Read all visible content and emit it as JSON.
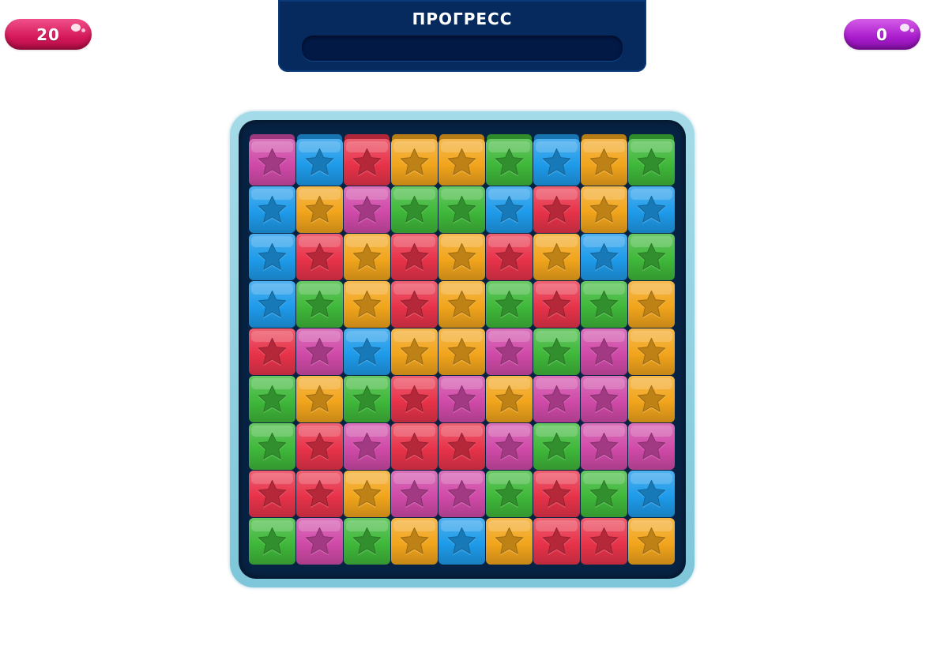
{
  "hud": {
    "moves_left": "20",
    "score": "0",
    "progress_label": "ПРОГРЕСС",
    "progress_fraction": 0
  },
  "colors": {
    "pink": "#d04aa8",
    "blue": "#1e9bea",
    "red": "#e8334a",
    "orange": "#f2a51c",
    "green": "#3fb83a",
    "board_bg": "#072344",
    "panel_bg": "#062a5e",
    "frame": "#9dd6e6"
  },
  "board": {
    "rows": [
      [
        "pink",
        "blue",
        "red",
        "orange",
        "orange",
        "green",
        "blue",
        "orange",
        "green"
      ],
      [
        "blue",
        "orange",
        "pink",
        "green",
        "green",
        "blue",
        "red",
        "orange",
        "blue"
      ],
      [
        "blue",
        "red",
        "orange",
        "red",
        "orange",
        "red",
        "orange",
        "blue",
        "green"
      ],
      [
        "blue",
        "green",
        "orange",
        "red",
        "orange",
        "green",
        "red",
        "green",
        "orange"
      ],
      [
        "red",
        "pink",
        "blue",
        "orange",
        "orange",
        "pink",
        "green",
        "pink",
        "orange"
      ],
      [
        "green",
        "orange",
        "green",
        "red",
        "pink",
        "orange",
        "pink",
        "pink",
        "orange"
      ],
      [
        "green",
        "red",
        "pink",
        "red",
        "red",
        "pink",
        "green",
        "pink",
        "pink"
      ],
      [
        "red",
        "red",
        "orange",
        "pink",
        "pink",
        "green",
        "red",
        "green",
        "blue"
      ],
      [
        "green",
        "pink",
        "green",
        "orange",
        "blue",
        "orange",
        "red",
        "red",
        "orange"
      ]
    ],
    "tile_icon": "star-icon"
  }
}
